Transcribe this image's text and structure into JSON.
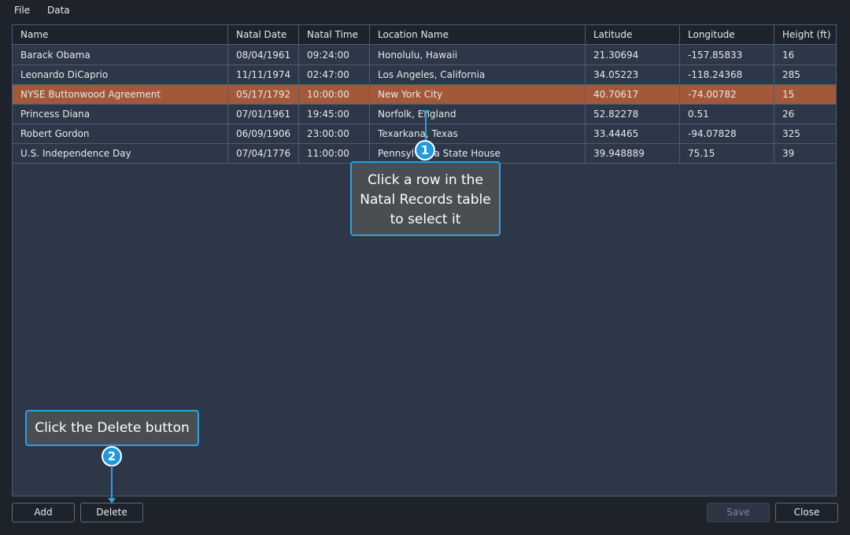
{
  "menu": {
    "file_label": "File",
    "data_label": "Data"
  },
  "table": {
    "columns": [
      "Name",
      "Natal Date",
      "Natal Time",
      "Location Name",
      "Latitude",
      "Longitude",
      "Height (ft)"
    ],
    "rows": [
      [
        "Barack Obama",
        "08/04/1961",
        "09:24:00",
        "Honolulu, Hawaii",
        "21.30694",
        "-157.85833",
        "16"
      ],
      [
        "Leonardo DiCaprio",
        "11/11/1974",
        "02:47:00",
        "Los Angeles, California",
        "34.05223",
        "-118.24368",
        "285"
      ],
      [
        "NYSE Buttonwood Agreement",
        "05/17/1792",
        "10:00:00",
        "New York City",
        "40.70617",
        "-74.00782",
        "15"
      ],
      [
        "Princess Diana",
        "07/01/1961",
        "19:45:00",
        "Norfolk, England",
        "52.82278",
        "0.51",
        "26"
      ],
      [
        "Robert Gordon",
        "06/09/1906",
        "23:00:00",
        "Texarkana, Texas",
        "33.44465",
        "-94.07828",
        "325"
      ],
      [
        "U.S. Independence Day",
        "07/04/1776",
        "11:00:00",
        "Pennsylvania State House",
        "39.948889",
        "75.15",
        "39"
      ]
    ],
    "selected_row_label": "NYSE Buttonwood Agreement"
  },
  "buttons": {
    "add_label": "Add",
    "delete_label": "Delete",
    "save_label": "Save",
    "close_label": "Close"
  },
  "callouts": {
    "step1": {
      "number": "1",
      "line1": "Click a row in the",
      "line2": "Natal Records table",
      "line3": "to select it"
    },
    "step2": {
      "number": "2",
      "text": "Click the Delete button"
    }
  },
  "colors": {
    "selection": "#a3583a",
    "accent": "#29a3e0",
    "panel": "#2d3747",
    "background": "#1e222b"
  }
}
